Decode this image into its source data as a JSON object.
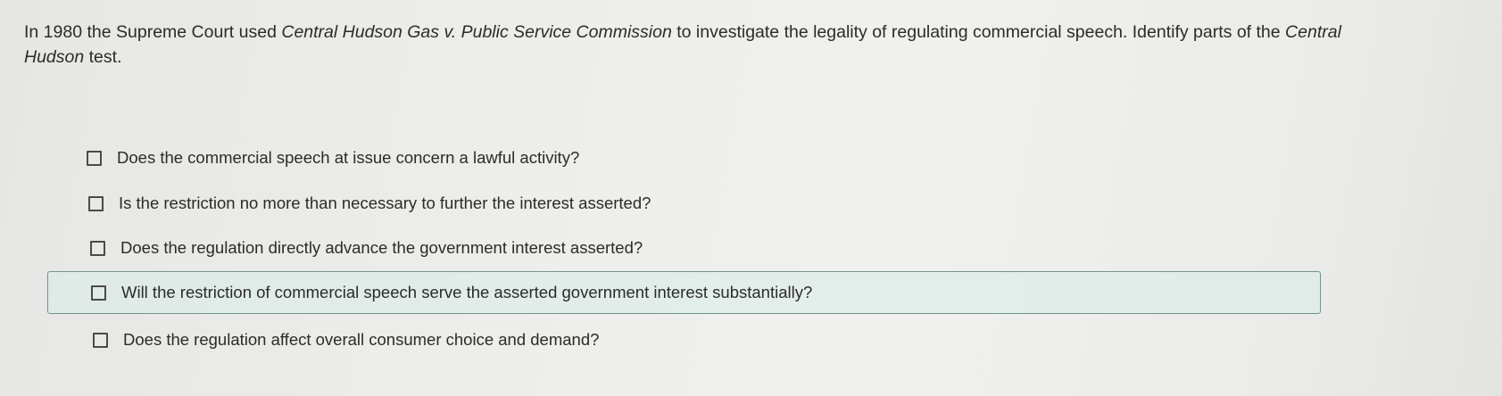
{
  "question": {
    "part1": "In 1980 the Supreme Court used ",
    "case_name": "Central Hudson Gas v. Public Service Commission",
    "part2": " to investigate the legality of regulating commercial speech. Identify parts of the ",
    "test_name": "Central Hudson",
    "part3": " test."
  },
  "options": [
    {
      "label": "Does the commercial speech at issue concern a lawful activity?",
      "checked": false
    },
    {
      "label": "Is the restriction no more than necessary to further the interest asserted?",
      "checked": false
    },
    {
      "label": "Does the regulation directly advance the government interest asserted?",
      "checked": false
    },
    {
      "label": "Will the restriction of commercial speech serve the asserted government interest substantially?",
      "checked": false,
      "highlighted": true
    },
    {
      "label": "Does the regulation affect overall consumer choice and demand?",
      "checked": false
    }
  ],
  "colors": {
    "highlight_border": "#6f9590",
    "highlight_fill": "#d8ece8",
    "text": "#2b2b2b"
  }
}
